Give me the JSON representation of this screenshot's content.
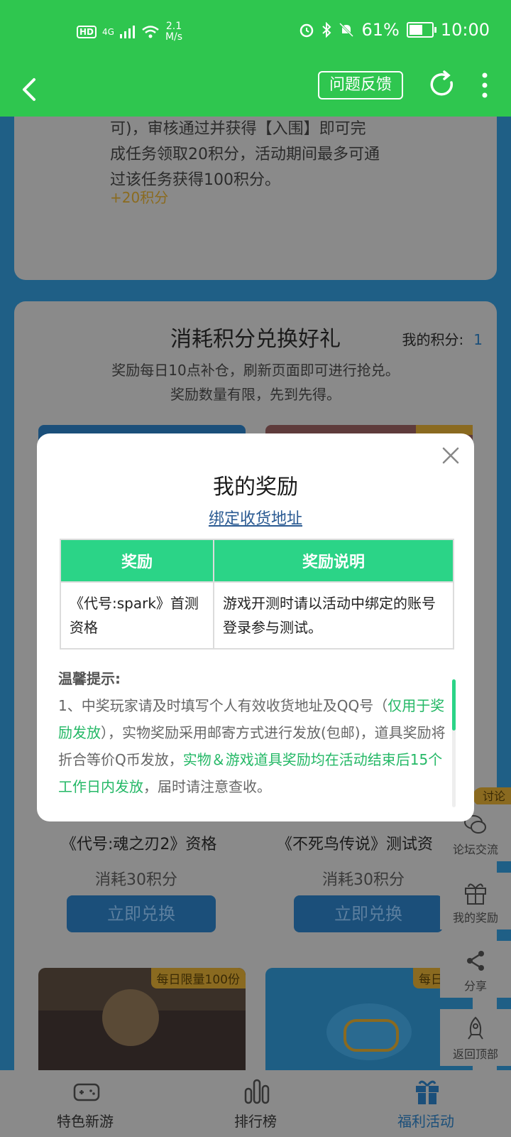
{
  "status_bar": {
    "network_hd": "HD",
    "network_gen": "4G",
    "speed_value": "2.1",
    "speed_unit": "M/s",
    "battery": "61%",
    "battery_level": 0.61,
    "time": "10:00"
  },
  "app_bar": {
    "feedback_label": "问题反馈"
  },
  "task_card": {
    "text_top": "可)，审核通过并获得【入围】即可完成任务领取20积分，活动期间最多可通过该任务获得100积分。",
    "points": "+20积分"
  },
  "exchange": {
    "title": "消耗积分兑换好礼",
    "my_points_label": "我的积分:",
    "my_points_value": "1",
    "desc_line1": "奖励每日10点补仓，刷新页面即可进行抢兑。",
    "desc_line2": "奖励数量有限，先到先得。",
    "products": [
      {
        "name": "《代号:魂之刃2》资格",
        "cost": "消耗30积分",
        "button": "立即兑换"
      },
      {
        "name": "《不死鸟传说》测试资",
        "cost": "消耗30积分",
        "button": "立即兑换"
      }
    ],
    "badges": [
      "每日限量100份",
      "每日限量"
    ]
  },
  "side_menu": {
    "forum_badge": "讨论",
    "items": [
      "论坛交流",
      "我的奖励",
      "分享",
      "返回顶部"
    ]
  },
  "tab_bar": {
    "tabs": [
      "特色新游",
      "排行榜",
      "福利活动"
    ]
  },
  "modal": {
    "title": "我的奖励",
    "bind_link": "绑定收货地址",
    "table": {
      "headers": [
        "奖励",
        "奖励说明"
      ],
      "rows": [
        [
          "《代号:spark》首测资格",
          "游戏开测时请以活动中绑定的账号登录参与测试。"
        ]
      ]
    },
    "tips_title": "温馨提示:",
    "tips": {
      "part1": "1、中奖玩家请及时填写个人有效收货地址及QQ号（",
      "part2_hl": "仅用于奖励发放",
      "part3": "），实物奖励采用邮寄方式进行发放(包邮)，道具奖励将折合等价Q币发放，",
      "part4_hl": "实物＆游戏道具奖励均在活动结束后15个工作日内发放",
      "part5": "，届时请注意查收。"
    }
  },
  "colors": {
    "green": "#2fc64f",
    "table_header": "#2bd487",
    "highlight": "#24b866",
    "link": "#2a5a92"
  }
}
